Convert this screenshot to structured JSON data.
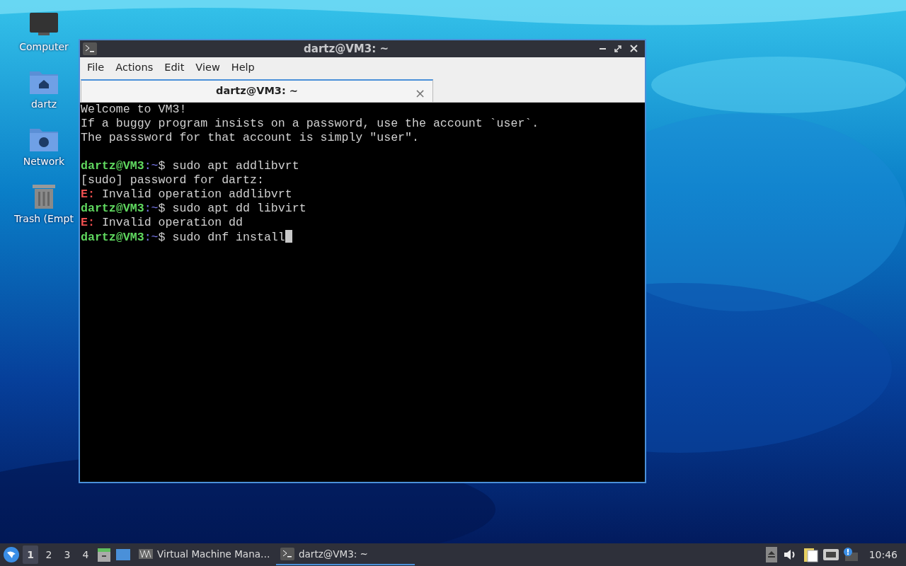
{
  "desktop_icons": [
    {
      "kind": "computer",
      "label": "Computer"
    },
    {
      "kind": "home",
      "label": "dartz"
    },
    {
      "kind": "network",
      "label": "Network"
    },
    {
      "kind": "trash",
      "label": "Trash (Empt"
    }
  ],
  "window": {
    "title": "dartz@VM3: ~",
    "menu": [
      "File",
      "Actions",
      "Edit",
      "View",
      "Help"
    ],
    "tabs": [
      {
        "label": "dartz@VM3: ~",
        "selected": true,
        "close": "×"
      }
    ],
    "terminal_lines": [
      {
        "kind": "text",
        "text": "Welcome to VM3!"
      },
      {
        "kind": "text",
        "text": "If a buggy program insists on a password, use the account `user`."
      },
      {
        "kind": "text",
        "text": "The passsword for that account is simply \"user\"."
      },
      {
        "kind": "blank"
      },
      {
        "kind": "prompt",
        "user": "dartz@VM3",
        "path": ":~",
        "symbol": "$",
        "command": " sudo apt addlibvrt",
        "cursor": false
      },
      {
        "kind": "text",
        "text": "[sudo] password for dartz:"
      },
      {
        "kind": "error",
        "label": "E:",
        "text": " Invalid operation addlibvrt"
      },
      {
        "kind": "prompt",
        "user": "dartz@VM3",
        "path": ":~",
        "symbol": "$",
        "command": " sudo apt dd libvirt",
        "cursor": false
      },
      {
        "kind": "error",
        "label": "E:",
        "text": " Invalid operation dd"
      },
      {
        "kind": "prompt",
        "user": "dartz@VM3",
        "path": ":~",
        "symbol": "$",
        "command": " sudo dnf install",
        "cursor": true
      }
    ]
  },
  "taskbar": {
    "workspaces": [
      {
        "label": "1",
        "selected": true
      },
      {
        "label": "2",
        "selected": false
      },
      {
        "label": "3",
        "selected": false
      },
      {
        "label": "4",
        "selected": false
      }
    ],
    "tasks": [
      {
        "kind": "vm",
        "label": "Virtual Machine Mana…",
        "selected": false
      },
      {
        "kind": "terminal",
        "label": "dartz@VM3: ~",
        "selected": true
      }
    ],
    "clock": "10:46"
  }
}
